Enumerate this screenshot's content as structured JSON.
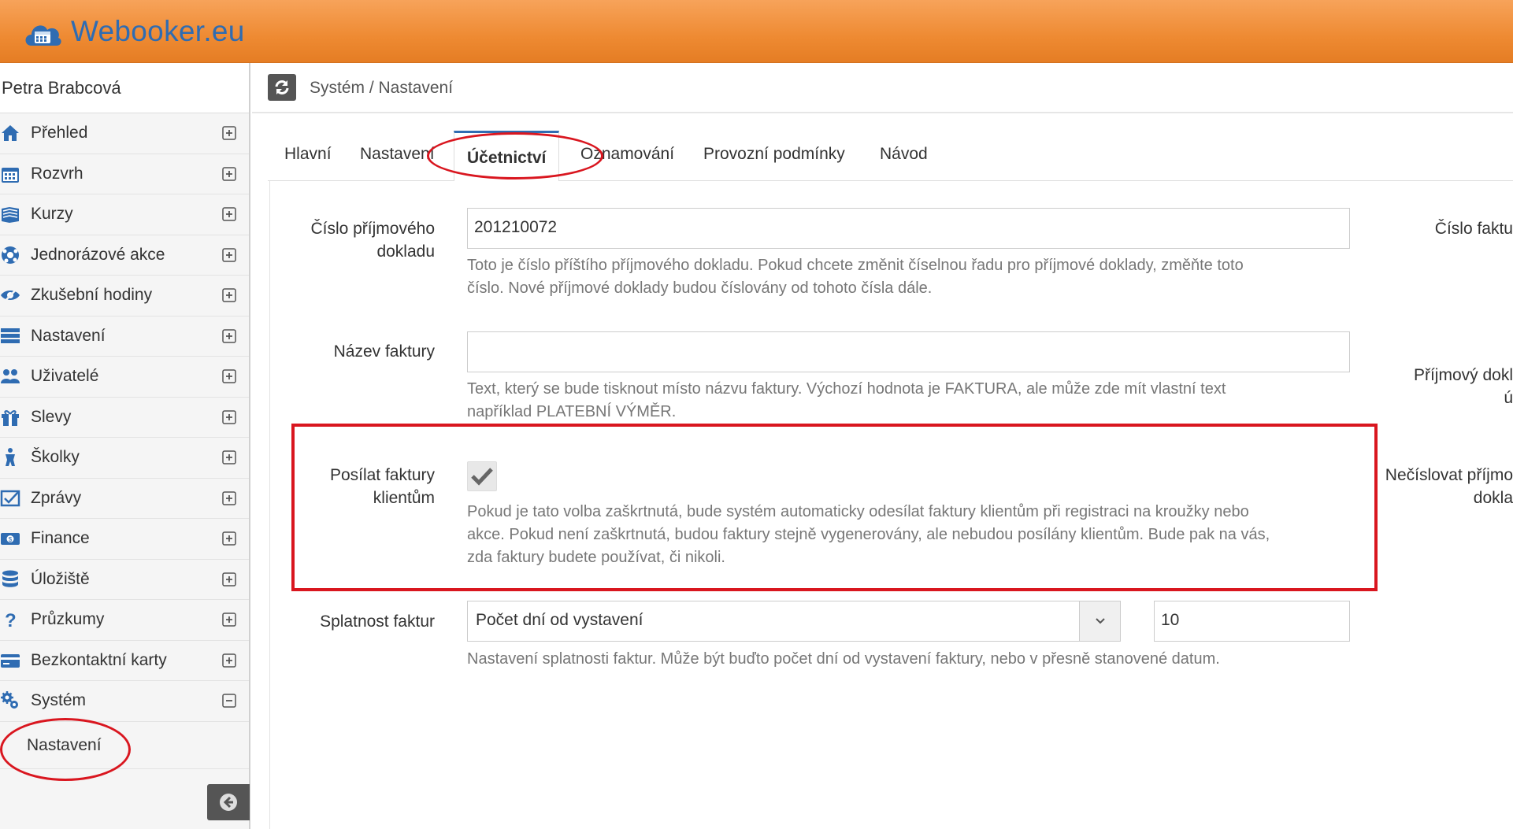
{
  "brand": {
    "name": "Webooker.eu"
  },
  "user": {
    "name": "Petra Brabcová"
  },
  "sidebar": {
    "items": [
      {
        "label": "Přehled",
        "icon": "home-icon"
      },
      {
        "label": "Rozvrh",
        "icon": "calendar-icon"
      },
      {
        "label": "Kurzy",
        "icon": "book-icon"
      },
      {
        "label": "Jednorázové akce",
        "icon": "ball-icon"
      },
      {
        "label": "Zkušební hodiny",
        "icon": "eye-icon"
      },
      {
        "label": "Nastavení",
        "icon": "server-icon"
      },
      {
        "label": "Uživatelé",
        "icon": "users-icon"
      },
      {
        "label": "Slevy",
        "icon": "gift-icon"
      },
      {
        "label": "Školky",
        "icon": "child-icon"
      },
      {
        "label": "Zprávy",
        "icon": "message-icon"
      },
      {
        "label": "Finance",
        "icon": "money-icon"
      },
      {
        "label": "Úložiště",
        "icon": "database-icon"
      },
      {
        "label": "Průzkumy",
        "icon": "question-icon"
      },
      {
        "label": "Bezkontaktní karty",
        "icon": "card-icon"
      },
      {
        "label": "Systém",
        "icon": "cogs-icon"
      }
    ],
    "sub_item": "Nastavení"
  },
  "breadcrumb": "Systém / Nastavení",
  "tabs": [
    "Hlavní",
    "Nastavení",
    "Účetnictví",
    "Oznamování",
    "Provozní podmínky",
    "Návod"
  ],
  "form": {
    "receipt_number": {
      "label_line1": "Číslo příjmového",
      "label_line2": "dokladu",
      "value": "201210072",
      "help_line1": "Toto je číslo příštího příjmového dokladu. Pokud chcete změnit číselnou řadu pro příjmové doklady, změňte toto",
      "help_line2": "číslo. Nové příjmové doklady budou číslovány od tohoto čísla dále."
    },
    "invoice_name": {
      "label": "Název faktury",
      "value": "",
      "help_line1": "Text, který se bude tisknout místo názvu faktury. Výchozí hodnota je FAKTURA, ale může zde mít vlastní text",
      "help_line2": "například PLATEBNÍ VÝMĚR."
    },
    "send_invoices": {
      "label_line1": "Posílat faktury",
      "label_line2": "klientům",
      "checked": true,
      "help_line1": "Pokud je tato volba zaškrtnutá, bude systém automaticky odesílat faktury klientům při registraci na kroužky nebo",
      "help_line2": "akce. Pokud není zaškrtnutá, budou faktury stejně vygenerovány, ale nebudou posílány klientům. Bude pak na vás,",
      "help_line3": "zda faktury budete používat, či nikoli."
    },
    "due_date": {
      "label": "Splatnost faktur",
      "select_value": "Počet dní od vystavení",
      "days_value": "10",
      "help": "Nastavení splatnosti faktur. Může být buďto počet dní od vystavení faktury, nebo v přesně stanovené datum."
    }
  },
  "right_column": {
    "invoice_number_label": "Číslo faktu",
    "receipt_label_line1": "Příjmový dokl",
    "receipt_label_line2": "ú",
    "no_numbering_line1": "Nečíslovat příjmo",
    "no_numbering_line2": "dokla"
  },
  "colors": {
    "header": "#ee8a32",
    "brand_text": "#2f6cb2",
    "highlight": "#d9161f"
  }
}
